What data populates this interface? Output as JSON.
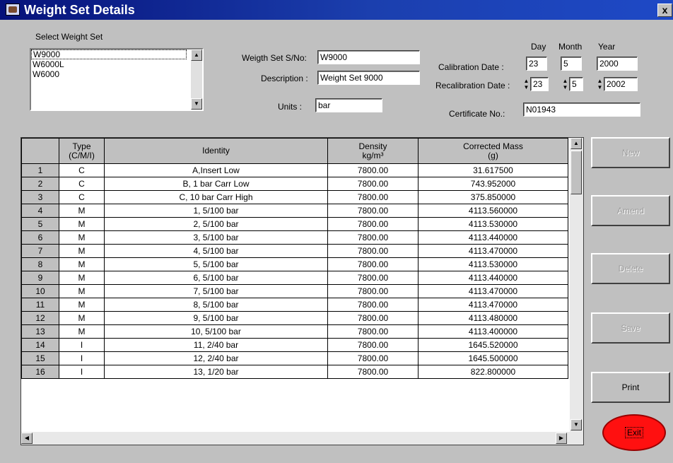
{
  "window": {
    "title": "Weight Set Details",
    "close_label": "x"
  },
  "select_weight_set": {
    "label": "Select Weight Set",
    "items": [
      "W9000",
      "W6000L",
      "W6000"
    ]
  },
  "form": {
    "serial_label": "Weigth Set S/No:",
    "serial_value": "W9000",
    "description_label": "Description :",
    "description_value": "Weight Set 9000",
    "units_label": "Units :",
    "units_value": "bar",
    "day_label": "Day",
    "month_label": "Month",
    "year_label": "Year",
    "calibration_label": "Calibration Date :",
    "calibration_day": "23",
    "calibration_month": "5",
    "calibration_year": "2000",
    "recalibration_label": "Recalibration Date :",
    "recalibration_day": "23",
    "recalibration_month": "5",
    "recalibration_year": "2002",
    "certificate_label": "Certificate No.:",
    "certificate_value": "N01943"
  },
  "grid": {
    "headers": {
      "type_line1": "Type",
      "type_line2": "(C/M/I)",
      "identity": "Identity",
      "density_line1": "Density",
      "density_line2": "kg/m³",
      "mass_line1": "Corrected Mass",
      "mass_line2": "(g)"
    },
    "rows": [
      {
        "n": "1",
        "type": "C",
        "identity": "A,Insert Low",
        "density": "7800.00",
        "mass": "31.617500"
      },
      {
        "n": "2",
        "type": "C",
        "identity": "B, 1 bar Carr Low",
        "density": "7800.00",
        "mass": "743.952000"
      },
      {
        "n": "3",
        "type": "C",
        "identity": "C, 10 bar Carr High",
        "density": "7800.00",
        "mass": "375.850000"
      },
      {
        "n": "4",
        "type": "M",
        "identity": "1, 5/100 bar",
        "density": "7800.00",
        "mass": "4113.560000"
      },
      {
        "n": "5",
        "type": "M",
        "identity": "2, 5/100 bar",
        "density": "7800.00",
        "mass": "4113.530000"
      },
      {
        "n": "6",
        "type": "M",
        "identity": "3, 5/100 bar",
        "density": "7800.00",
        "mass": "4113.440000"
      },
      {
        "n": "7",
        "type": "M",
        "identity": "4, 5/100 bar",
        "density": "7800.00",
        "mass": "4113.470000"
      },
      {
        "n": "8",
        "type": "M",
        "identity": "5, 5/100 bar",
        "density": "7800.00",
        "mass": "4113.530000"
      },
      {
        "n": "9",
        "type": "M",
        "identity": "6, 5/100 bar",
        "density": "7800.00",
        "mass": "4113.440000"
      },
      {
        "n": "10",
        "type": "M",
        "identity": "7, 5/100 bar",
        "density": "7800.00",
        "mass": "4113.470000"
      },
      {
        "n": "11",
        "type": "M",
        "identity": "8, 5/100 bar",
        "density": "7800.00",
        "mass": "4113.470000"
      },
      {
        "n": "12",
        "type": "M",
        "identity": "9, 5/100 bar",
        "density": "7800.00",
        "mass": "4113.480000"
      },
      {
        "n": "13",
        "type": "M",
        "identity": "10, 5/100 bar",
        "density": "7800.00",
        "mass": "4113.400000"
      },
      {
        "n": "14",
        "type": "I",
        "identity": "11, 2/40 bar",
        "density": "7800.00",
        "mass": "1645.520000"
      },
      {
        "n": "15",
        "type": "I",
        "identity": "12, 2/40 bar",
        "density": "7800.00",
        "mass": "1645.500000"
      },
      {
        "n": "16",
        "type": "I",
        "identity": "13, 1/20 bar",
        "density": "7800.00",
        "mass": "822.800000"
      }
    ]
  },
  "buttons": {
    "new": "New",
    "amend": "Amend",
    "delete": "Delete",
    "save": "Save",
    "print": "Print",
    "exit": "Exit"
  },
  "colors": {
    "window_bg": "#c0c0c0",
    "title_bar": "#0a246a",
    "exit_button": "#ff1010"
  }
}
